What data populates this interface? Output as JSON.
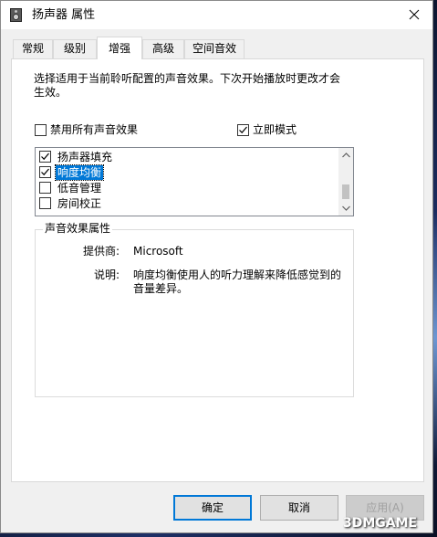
{
  "window": {
    "title": "扬声器 属性"
  },
  "tabs": [
    {
      "label": "常规",
      "active": false
    },
    {
      "label": "级别",
      "active": false
    },
    {
      "label": "增强",
      "active": true
    },
    {
      "label": "高级",
      "active": false
    },
    {
      "label": "空间音效",
      "active": false
    }
  ],
  "enhancements": {
    "description": "选择适用于当前聆听配置的声音效果。下次开始播放时更改才会生效。",
    "disable_all": {
      "label": "禁用所有声音效果",
      "checked": false
    },
    "immediate_mode": {
      "label": "立即模式",
      "checked": true
    },
    "effects": [
      {
        "label": "扬声器填充",
        "checked": true,
        "selected": false
      },
      {
        "label": "响度均衡",
        "checked": true,
        "selected": true
      },
      {
        "label": "低音管理",
        "checked": false,
        "selected": false
      },
      {
        "label": "房间校正",
        "checked": false,
        "selected": false
      }
    ],
    "properties": {
      "legend": "声音效果属性",
      "provider_label": "提供商:",
      "provider_value": "Microsoft",
      "description_label": "说明:",
      "description_value": "响度均衡使用人的听力理解来降低感觉到的音量差异。"
    }
  },
  "buttons": {
    "ok": "确定",
    "cancel": "取消",
    "apply": "应用(A)"
  },
  "watermark": {
    "text": "3DMGAME"
  },
  "colors": {
    "selection": "#0078d7",
    "window_bg": "#f0f0f0"
  }
}
